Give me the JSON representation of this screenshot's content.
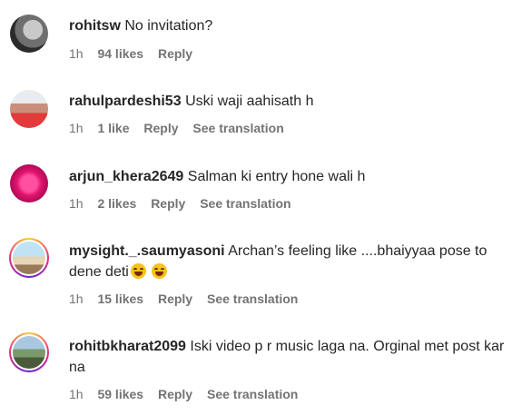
{
  "comments": [
    {
      "username": "rohitsw",
      "text": "No invitation?",
      "time": "1h",
      "likes": "94 likes",
      "reply": "Reply",
      "translate": ""
    },
    {
      "username": "rahulpardeshi53",
      "text": "Uski waji aahisath h",
      "time": "1h",
      "likes": "1 like",
      "reply": "Reply",
      "translate": "See translation"
    },
    {
      "username": "arjun_khera2649",
      "text": "Salman ki entry hone wali h",
      "time": "1h",
      "likes": "2 likes",
      "reply": "Reply",
      "translate": "See translation"
    },
    {
      "username": "mysight._.saumyasoni",
      "text": "Archan’s feeling like ....bhaiyyaa pose to dene deti",
      "time": "1h",
      "likes": "15 likes",
      "reply": "Reply",
      "translate": "See translation"
    },
    {
      "username": "rohitbkharat2099",
      "text": "Iski video p r music laga na. Orginal met post kar na",
      "time": "1h",
      "likes": "59 likes",
      "reply": "Reply",
      "translate": "See translation"
    }
  ],
  "icons": {
    "emoji": "face-with-tears-of-joy-icon"
  }
}
